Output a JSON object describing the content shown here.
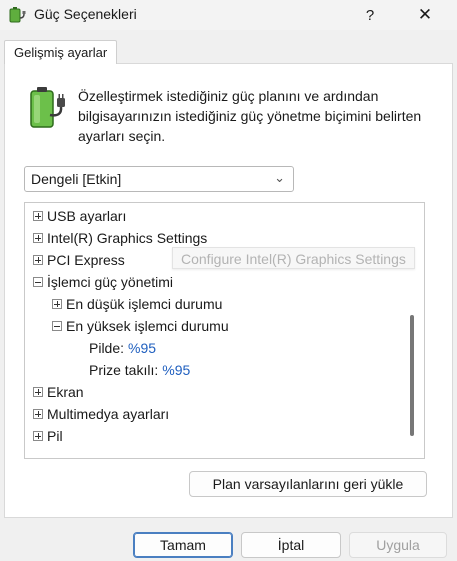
{
  "window": {
    "title": "Güç Seçenekleri",
    "help_label": "?",
    "close_label": "✕"
  },
  "tab": {
    "label": "Gelişmiş ayarlar"
  },
  "description": "Özelleştirmek istediğiniz güç planını ve ardından bilgisayarınızın istediğiniz güç yönetme biçimini belirten ayarları seçin.",
  "plan_select": {
    "value": "Dengeli [Etkin]"
  },
  "tree": {
    "items": [
      {
        "label": "USB ayarları",
        "expander": "plus"
      },
      {
        "label": "Intel(R) Graphics Settings",
        "expander": "plus"
      },
      {
        "label": "PCI Express",
        "expander": "plus"
      },
      {
        "label": "İşlemci güç yönetimi",
        "expander": "minus"
      },
      {
        "label": "En düşük işlemci durumu",
        "expander": "plus"
      },
      {
        "label": "En yüksek işlemci durumu",
        "expander": "minus"
      },
      {
        "label": "Pilde:",
        "value": "%95"
      },
      {
        "label": "Prize takılı:",
        "value": "%95"
      },
      {
        "label": "Ekran",
        "expander": "plus"
      },
      {
        "label": "Multimedya ayarları",
        "expander": "plus"
      },
      {
        "label": "Pil",
        "expander": "plus"
      }
    ]
  },
  "tooltip": {
    "text": "Configure Intel(R) Graphics Settings"
  },
  "buttons": {
    "restore": "Plan varsayılanlarını geri yükle",
    "ok": "Tamam",
    "cancel": "İptal",
    "apply": "Uygula"
  },
  "colors": {
    "value_link": "#1f5fbf",
    "ok_border": "#4a7fc1"
  },
  "icons": {
    "app": "battery-plug-icon",
    "dropdown": "chevron-down-icon"
  }
}
